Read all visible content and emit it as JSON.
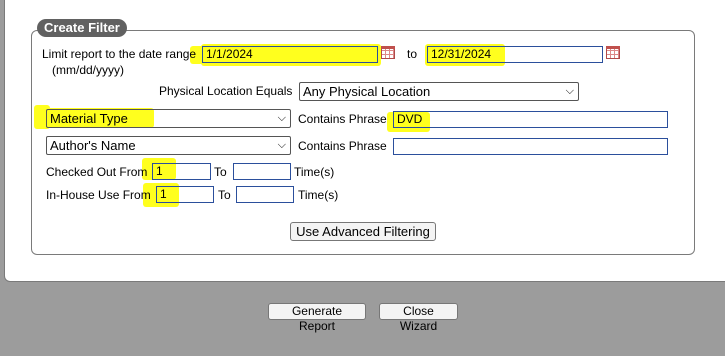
{
  "filter": {
    "title": "Create Filter",
    "date_range": {
      "label": "Limit report to the date range",
      "format_hint": "(mm/dd/yyyy)",
      "from_value": "1/1/2024",
      "to_label": "to",
      "to_value": "12/31/2024"
    },
    "physical_location": {
      "label": "Physical Location Equals",
      "selected": "Any Physical Location"
    },
    "row1": {
      "field_selected": "Material Type",
      "contains_label": "Contains Phrase",
      "phrase_value": "DVD"
    },
    "row2": {
      "field_selected": "Author's Name",
      "contains_label": "Contains Phrase",
      "phrase_value": ""
    },
    "checked_out": {
      "label": "Checked Out From",
      "from_value": "1",
      "to_label": "To",
      "to_value": "",
      "suffix": "Time(s)"
    },
    "in_house": {
      "label": "In-House Use From",
      "from_value": "1",
      "to_label": "To",
      "to_value": "",
      "suffix": "Time(s)"
    },
    "advanced_button": "Use Advanced Filtering"
  },
  "footer": {
    "generate_button": "Generate Report",
    "close_button": "Close Wizard"
  },
  "colors": {
    "highlight": "#ffff1e",
    "legend_bg": "#616161",
    "page_bg": "#9c9c9c"
  },
  "icons": {
    "calendar": "calendar-icon",
    "dropdown": "chevron-down-icon"
  }
}
